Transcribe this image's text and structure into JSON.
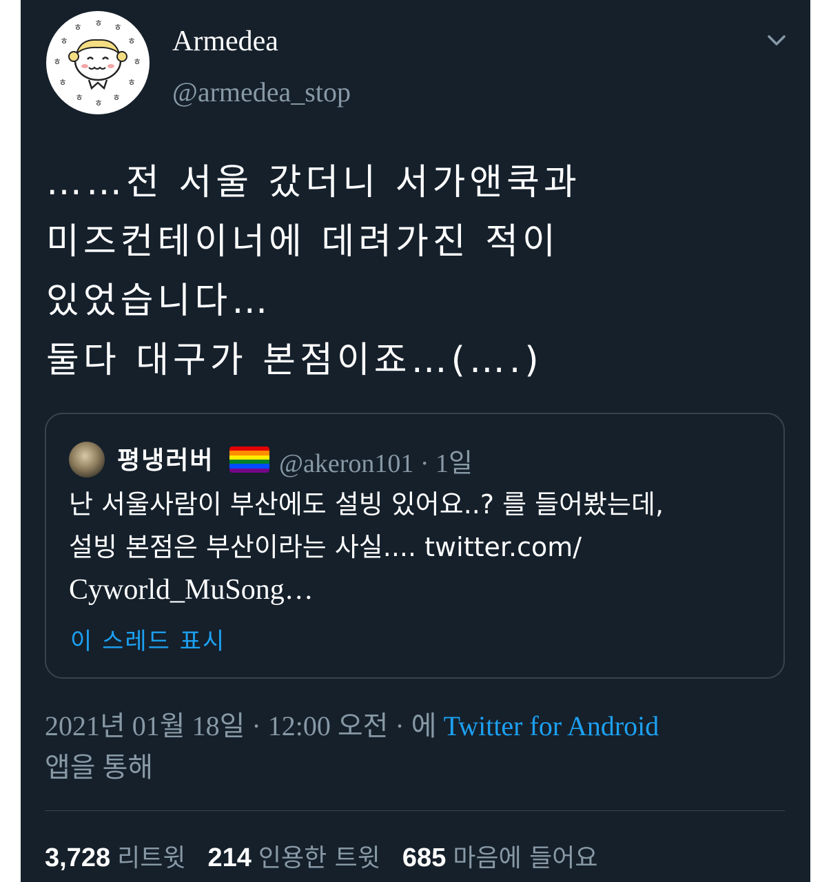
{
  "tweet": {
    "display_name": "Armedea",
    "handle": "@armedea_stop",
    "body_lines": [
      "……전 서울 갔더니 서가앤쿡과",
      "미즈컨테이너에 데려가진 적이",
      "있었습니다…",
      "둘다 대구가 본점이죠…(….)"
    ]
  },
  "quoted": {
    "name": "평냉러버",
    "handle_time": "@akeron101 · 1일",
    "text_lines": [
      "난 서울사람이 부산에도 설빙 있어요..? 를 들어봤는데,",
      "설빙 본점은 부산이라는 사실.... twitter.com/",
      "Cyworld_MuSong…"
    ],
    "show_thread": "이 스레드 표시"
  },
  "meta": {
    "date": "2021년 01월 18일 · 12:00 오전 · 에 ",
    "source": "Twitter for Android",
    "suffix": "앱을 통해"
  },
  "stats": {
    "retweets_count": "3,728",
    "retweets_label": "리트윗",
    "quotes_count": "214",
    "quotes_label": "인용한 트윗",
    "likes_count": "685",
    "likes_label": "마음에 들어요"
  },
  "colors": {
    "background": "#15202b",
    "secondary_text": "#8899a6",
    "link": "#1da1f2",
    "border": "#38444d",
    "rainbow": [
      "#e40303",
      "#ff8c00",
      "#ffed00",
      "#008026",
      "#004dff",
      "#750787"
    ]
  }
}
